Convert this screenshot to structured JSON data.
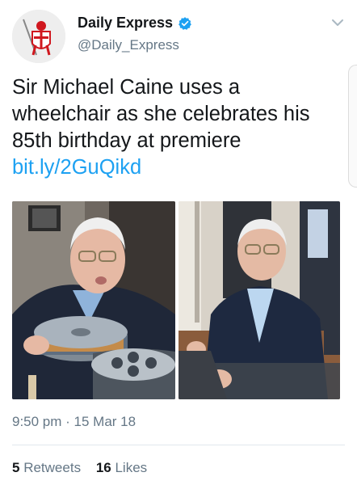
{
  "account": {
    "display_name": "Daily Express",
    "handle": "@Daily_Express",
    "verified": true,
    "avatar_icon": "crusader-knight-logo-icon"
  },
  "tweet": {
    "text": "Sir Michael Caine uses a wheelchair as she celebrates his 85th birthday at premiere ",
    "link": "bit.ly/2GuQikd",
    "timestamp": "9:50 pm · 15 Mar 18"
  },
  "stats": {
    "retweets_count": "5",
    "retweets_label": "Retweets",
    "likes_count": "16",
    "likes_label": "Likes"
  },
  "colors": {
    "link": "#1da1f2",
    "secondary_text": "#657786",
    "verified_badge": "#1da1f2",
    "logo_red": "#d0181f"
  }
}
